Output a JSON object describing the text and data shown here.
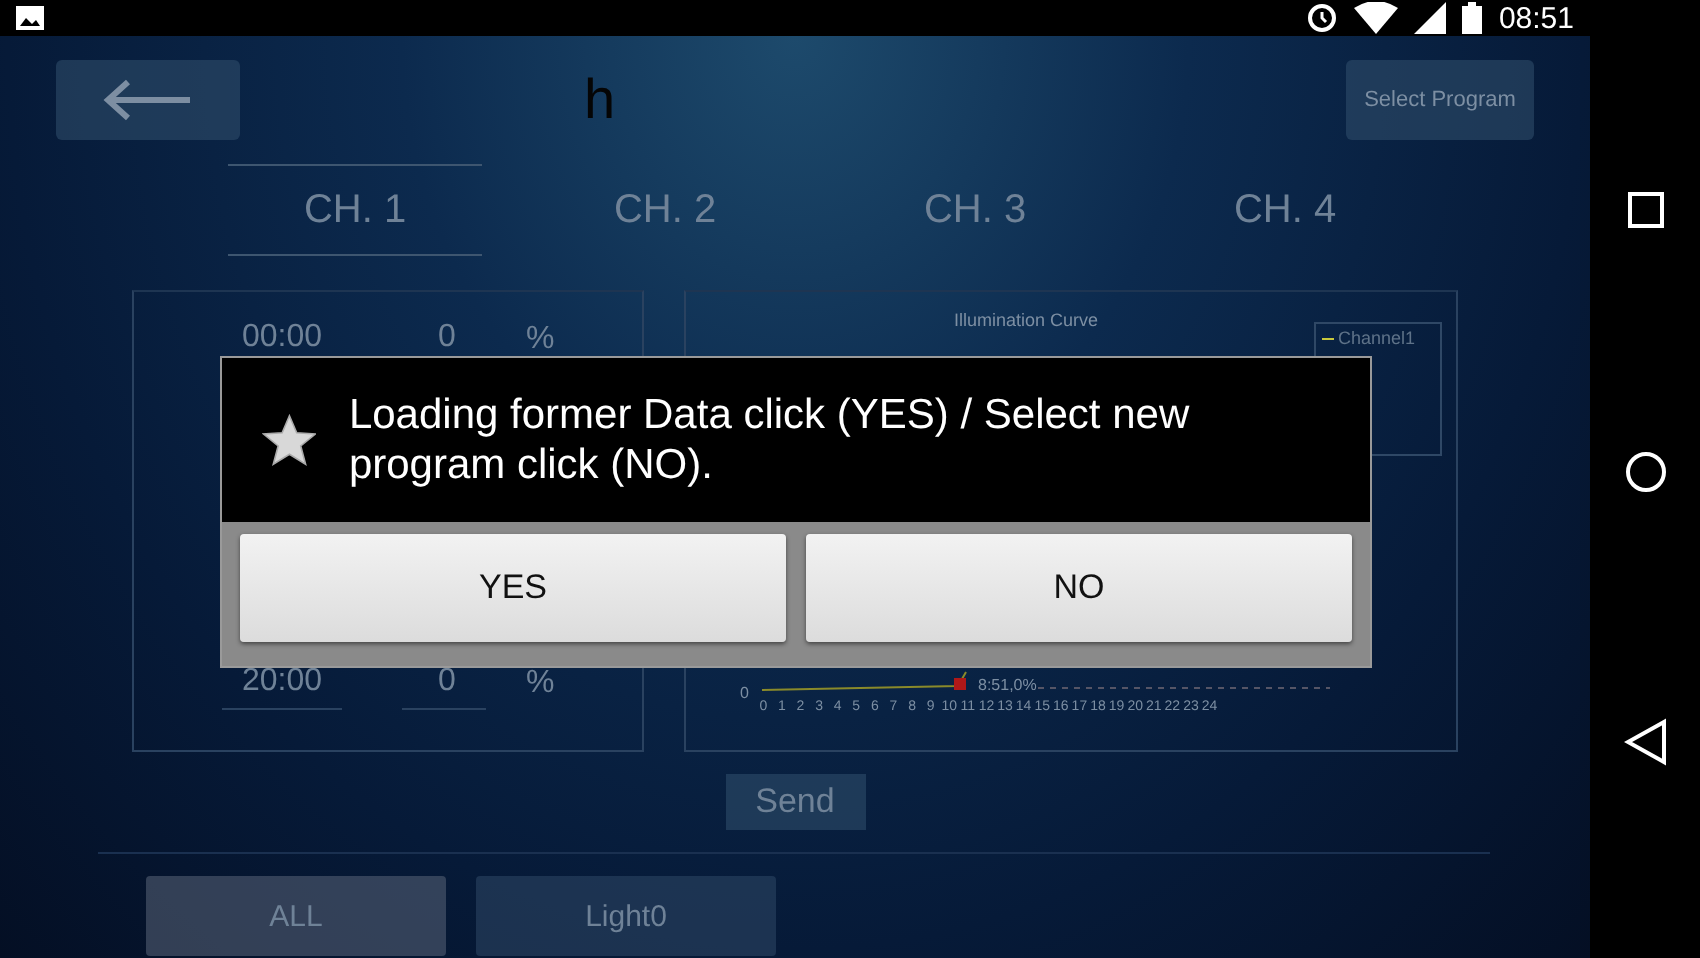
{
  "status_bar": {
    "time": "08:51"
  },
  "header": {
    "title": "h",
    "select_button": "Select Program"
  },
  "tabs": [
    {
      "label": "CH. 1",
      "selected": true
    },
    {
      "label": "CH. 2",
      "selected": false
    },
    {
      "label": "CH. 3",
      "selected": false
    },
    {
      "label": "CH. 4",
      "selected": false
    }
  ],
  "schedule": [
    {
      "time": "00:00",
      "value": "0",
      "unit": "%"
    },
    {
      "time": "20:00",
      "value": "0",
      "unit": "%"
    }
  ],
  "chart": {
    "title": "Illumination Curve",
    "legend": [
      {
        "name": "Channel1",
        "color": "#c8c83c"
      }
    ],
    "y_label": "0",
    "x_ticks": [
      "0",
      "1",
      "2",
      "3",
      "4",
      "5",
      "6",
      "7",
      "8",
      "9",
      "10",
      "11",
      "12",
      "13",
      "14",
      "15",
      "16",
      "17",
      "18",
      "19",
      "20",
      "21",
      "22",
      "23",
      "24"
    ],
    "marker_label": "8:51,0%"
  },
  "send_button": "Send",
  "groups": [
    {
      "label": "ALL",
      "selected": true
    },
    {
      "label": "Light0",
      "selected": false
    }
  ],
  "dialog": {
    "message": "Loading former Data click (YES) / Select new program click (NO).",
    "buttons": [
      "YES",
      "NO"
    ]
  }
}
